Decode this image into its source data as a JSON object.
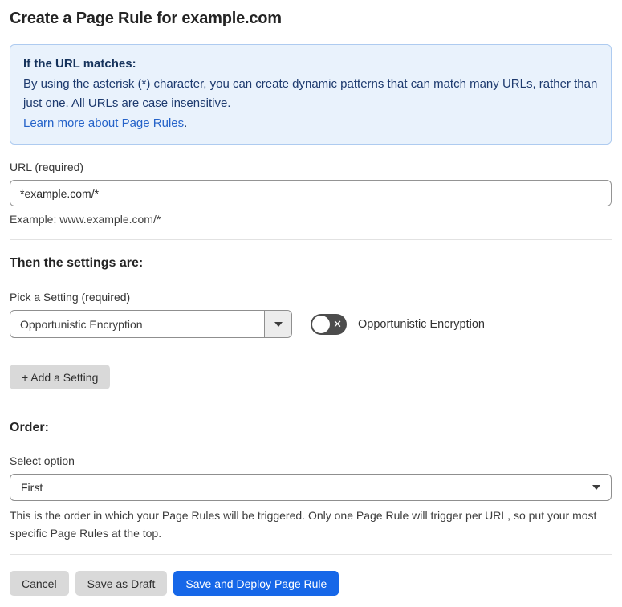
{
  "page": {
    "title": "Create a Page Rule for example.com"
  },
  "info_box": {
    "heading": "If the URL matches:",
    "body": "By using the asterisk (*) character, you can create dynamic patterns that can match many URLs, rather than just one. All URLs are case insensitive.",
    "link": "Learn more about Page Rules",
    "link_suffix": "."
  },
  "url_field": {
    "label": "URL (required)",
    "value": "*example.com/*",
    "help": "Example: www.example.com/*"
  },
  "settings": {
    "heading": "Then the settings are:",
    "picker_label": "Pick a Setting (required)",
    "picker_value": "Opportunistic Encryption",
    "toggle_state": "off",
    "toggle_x": "✕",
    "toggle_label": "Opportunistic Encryption",
    "add_button": "+ Add a Setting"
  },
  "order": {
    "heading": "Order:",
    "label": "Select option",
    "value": "First",
    "help": "This is the order in which your Page Rules will be triggered. Only one Page Rule will trigger per URL, so put your most specific Page Rules at the top."
  },
  "actions": {
    "cancel": "Cancel",
    "save_draft": "Save as Draft",
    "save_deploy": "Save and Deploy Page Rule"
  },
  "colors": {
    "accent_blue": "#1667e8",
    "info_bg": "#e9f2fc",
    "info_border": "#aecbf0",
    "info_text": "#1d3a6e",
    "link_blue": "#2563c9",
    "toggle_off_bg": "#4c4c4c",
    "button_gray": "#d9d9d9"
  }
}
